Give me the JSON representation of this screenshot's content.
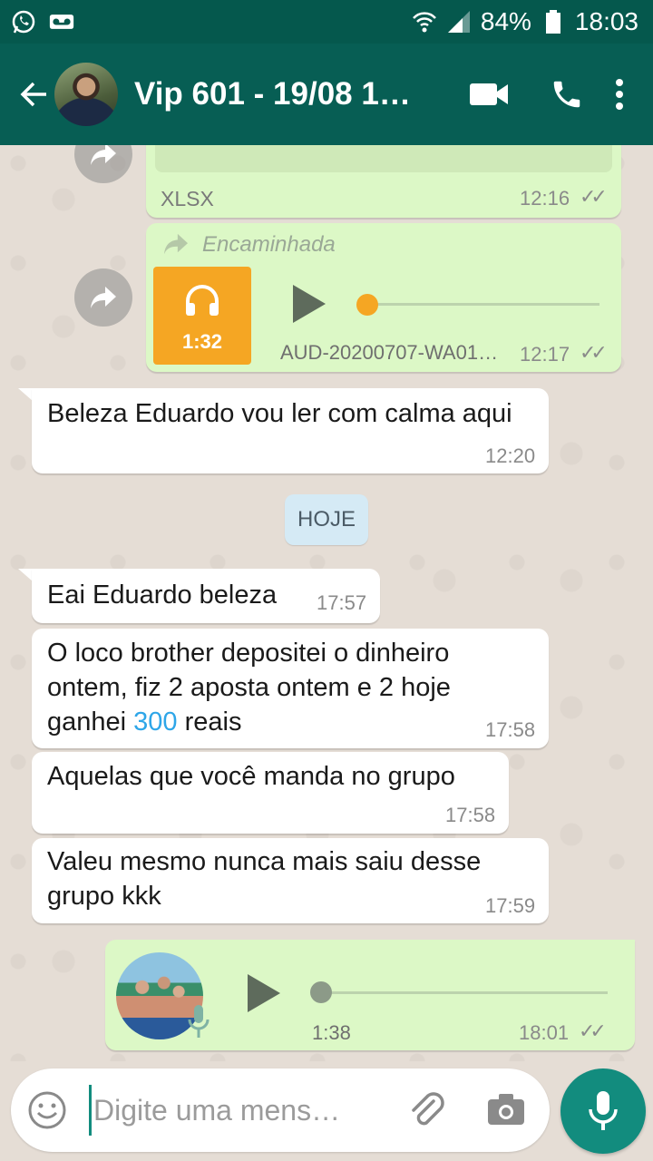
{
  "status_bar": {
    "battery": "84%",
    "time": "18:03"
  },
  "header": {
    "title": "Vip 601 - 19/08 1…"
  },
  "messages": {
    "m1": {
      "file_type": "XLSX",
      "time": "12:16"
    },
    "m2": {
      "forwarded_label": "Encaminhada",
      "duration": "1:32",
      "file_name": "AUD-20200707-WA01…",
      "time": "12:17"
    },
    "m3": {
      "text": "Beleza Eduardo vou ler com calma aqui",
      "time": "12:20"
    },
    "date_chip": "HOJE",
    "m4": {
      "text": "Eai Eduardo beleza",
      "time": "17:57"
    },
    "m5": {
      "text_before": "O loco brother depositei o dinheiro ontem, fiz 2 aposta ontem e 2 hoje ganhei ",
      "highlight": "300",
      "text_after": " reais",
      "time": "17:58"
    },
    "m6": {
      "text": "Aquelas que você manda no grupo",
      "time": "17:58"
    },
    "m7": {
      "text": "Valeu mesmo nunca mais saiu desse grupo kkk",
      "time": "17:59"
    },
    "m8": {
      "duration": "1:38",
      "time": "18:01"
    }
  },
  "composer": {
    "placeholder": "Digite uma mens…"
  },
  "colors": {
    "header": "#075e54",
    "status_bar": "#05584d",
    "outgoing_bubble": "#dcf8c6",
    "incoming_bubble": "#ffffff",
    "audio_orange": "#f5a623",
    "fab": "#128c7e",
    "highlight": "#2ea6e8"
  },
  "icons": [
    "whatsapp-icon",
    "voicemail-icon",
    "wifi-icon",
    "signal-icon",
    "battery-icon",
    "back-arrow-icon",
    "video-call-icon",
    "phone-icon",
    "more-vert-icon",
    "forward-icon",
    "headphones-icon",
    "play-icon",
    "double-check-icon",
    "emoji-icon",
    "attach-icon",
    "camera-icon",
    "mic-icon"
  ]
}
